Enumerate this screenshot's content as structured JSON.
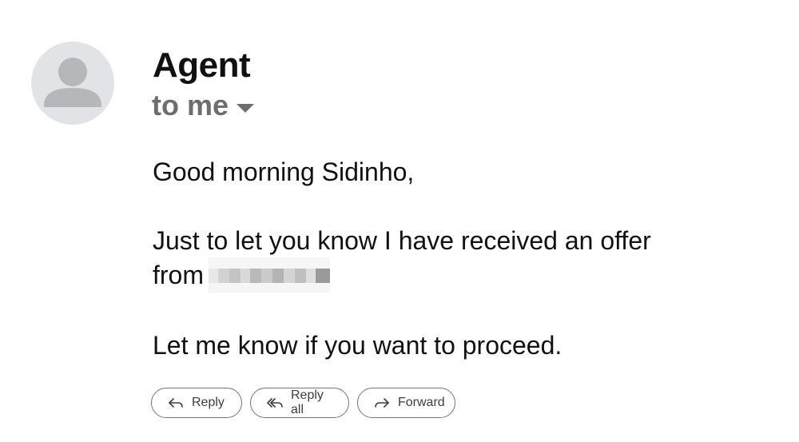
{
  "email": {
    "sender_name": "Agent",
    "recipient_label": "to me",
    "greeting": "Good morning Sidinho,",
    "paragraph1_part1": "Just to let you know I have received an offer",
    "paragraph1_part2": "from",
    "paragraph2": "Let me know if you want to proceed."
  },
  "actions": {
    "reply_label": "Reply",
    "reply_all_label": "Reply all",
    "forward_label": "Forward"
  },
  "icons": {
    "avatar": "person-silhouette-icon",
    "recipient_toggle": "caret-down-icon",
    "reply": "reply-arrow-icon",
    "reply_all": "reply-all-arrow-icon",
    "forward": "forward-arrow-icon"
  },
  "colors": {
    "avatar_bg": "#e1e3e6",
    "avatar_fg": "#b5b7ba",
    "text_primary": "#111111",
    "text_secondary": "#6b6d70",
    "button_border": "#747775"
  }
}
